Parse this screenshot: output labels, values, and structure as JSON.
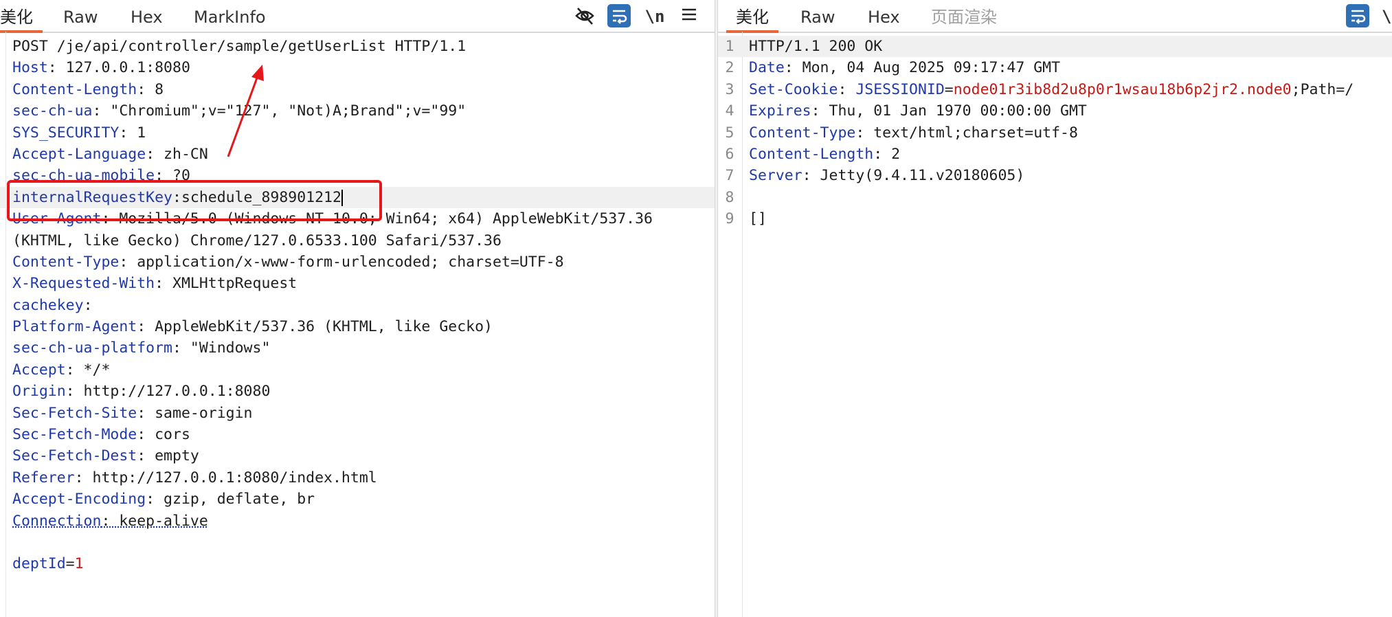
{
  "request": {
    "tabs": [
      "美化",
      "Raw",
      "Hex",
      "MarkInfo"
    ],
    "tools": {
      "newline_label": "\\n"
    },
    "lines": [
      [
        [
          "v",
          "POST /je/api/controller/sample/getUserList HTTP/1.1"
        ]
      ],
      [
        [
          "k",
          "Host"
        ],
        [
          "v",
          ": 127.0.0.1:8080"
        ]
      ],
      [
        [
          "k",
          "Content-Length"
        ],
        [
          "v",
          ": 8"
        ]
      ],
      [
        [
          "k",
          "sec-ch-ua"
        ],
        [
          "v",
          ": \"Chromium\";v=\"127\", \"Not)A;Brand\";v=\"99\""
        ]
      ],
      [
        [
          "k",
          "SYS_SECURITY"
        ],
        [
          "v",
          ": 1"
        ]
      ],
      [
        [
          "k",
          "Accept-Language"
        ],
        [
          "v",
          ": zh-CN"
        ]
      ],
      [
        [
          "k",
          "sec-ch-ua-mobile"
        ],
        [
          "v",
          ": ?0"
        ]
      ],
      [
        [
          "k",
          "internalRequestKey"
        ],
        [
          "v",
          ":schedule_898901212"
        ]
      ],
      [
        [
          "k",
          "User-Agent"
        ],
        [
          "v",
          ": Mozilla/5.0 (Windows NT 10.0; Win64; x64) AppleWebKit/537.36"
        ]
      ],
      [
        [
          "v",
          "(KHTML, like Gecko) Chrome/127.0.6533.100 Safari/537.36"
        ]
      ],
      [
        [
          "k",
          "Content-Type"
        ],
        [
          "v",
          ": application/x-www-form-urlencoded; charset=UTF-8"
        ]
      ],
      [
        [
          "k",
          "X-Requested-With"
        ],
        [
          "v",
          ": XMLHttpRequest"
        ]
      ],
      [
        [
          "k",
          "cachekey"
        ],
        [
          "v",
          ":"
        ]
      ],
      [
        [
          "k",
          "Platform-Agent"
        ],
        [
          "v",
          ": AppleWebKit/537.36 (KHTML, like Gecko)"
        ]
      ],
      [
        [
          "k",
          "sec-ch-ua-platform"
        ],
        [
          "v",
          ": \"Windows\""
        ]
      ],
      [
        [
          "k",
          "Accept"
        ],
        [
          "v",
          ": */*"
        ]
      ],
      [
        [
          "k",
          "Origin"
        ],
        [
          "v",
          ": http://127.0.0.1:8080"
        ]
      ],
      [
        [
          "k",
          "Sec-Fetch-Site"
        ],
        [
          "v",
          ": same-origin"
        ]
      ],
      [
        [
          "k",
          "Sec-Fetch-Mode"
        ],
        [
          "v",
          ": cors"
        ]
      ],
      [
        [
          "k",
          "Sec-Fetch-Dest"
        ],
        [
          "v",
          ": empty"
        ]
      ],
      [
        [
          "k",
          "Referer"
        ],
        [
          "v",
          ": http://127.0.0.1:8080/index.html"
        ]
      ],
      [
        [
          "k",
          "Accept-Encoding"
        ],
        [
          "v",
          ": gzip, deflate, br"
        ]
      ],
      [
        [
          "k",
          "Connection"
        ],
        [
          "v",
          ": keep-alive"
        ]
      ],
      [],
      [
        [
          "k",
          "deptId"
        ],
        [
          "v",
          "="
        ],
        [
          "r",
          "1"
        ]
      ]
    ]
  },
  "response": {
    "tabs": [
      "美化",
      "Raw",
      "Hex",
      "页面渲染"
    ],
    "tools": {
      "newline_label": "\\"
    },
    "lines": [
      {
        "n": "1",
        "parts": [
          [
            "v",
            "HTTP/1.1 200 OK"
          ]
        ]
      },
      {
        "n": "2",
        "parts": [
          [
            "k",
            "Date"
          ],
          [
            "v",
            ": Mon, 04 Aug 2025 09:17:47 GMT"
          ]
        ]
      },
      {
        "n": "3",
        "parts": [
          [
            "k",
            "Set-Cookie"
          ],
          [
            "v",
            ": "
          ],
          [
            "k",
            "JSESSIONID"
          ],
          [
            "v",
            "="
          ],
          [
            "r",
            "node01r3ib8d2u8p0r1wsau18b6p2jr2.node0"
          ],
          [
            "v",
            ";Path=/"
          ]
        ]
      },
      {
        "n": "4",
        "parts": [
          [
            "k",
            "Expires"
          ],
          [
            "v",
            ": Thu, 01 Jan 1970 00:00:00 GMT"
          ]
        ]
      },
      {
        "n": "5",
        "parts": [
          [
            "k",
            "Content-Type"
          ],
          [
            "v",
            ": text/html;charset=utf-8"
          ]
        ]
      },
      {
        "n": "6",
        "parts": [
          [
            "k",
            "Content-Length"
          ],
          [
            "v",
            ": 2"
          ]
        ]
      },
      {
        "n": "7",
        "parts": [
          [
            "k",
            "Server"
          ],
          [
            "v",
            ": Jetty(9.4.11.v20180605)"
          ]
        ]
      },
      {
        "n": "8",
        "parts": []
      },
      {
        "n": "9",
        "parts": [
          [
            "v",
            "[]"
          ]
        ]
      }
    ]
  },
  "colors": {
    "accent": "#e8663c",
    "key": "#1f3aa8",
    "value_red": "#c41a16",
    "highlight_box": "#e5171b",
    "tool_blue": "#2f6fb5"
  }
}
